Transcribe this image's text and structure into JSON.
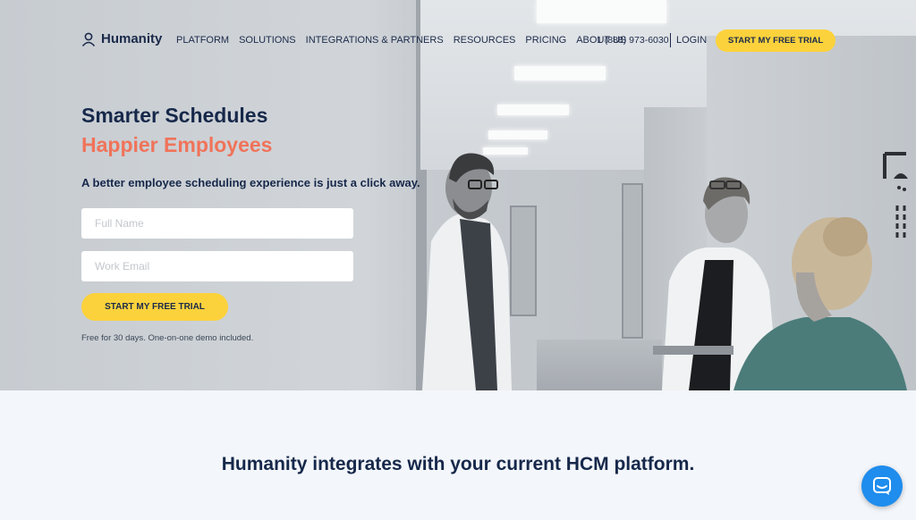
{
  "brand": {
    "name": "Humanity"
  },
  "nav": {
    "links": [
      "PLATFORM",
      "SOLUTIONS",
      "INTEGRATIONS & PARTNERS",
      "RESOURCES",
      "PRICING",
      "ABOUT US"
    ],
    "phone": "1 (888) 973-6030",
    "login": "LOGIN",
    "cta": "START MY FREE TRIAL"
  },
  "hero": {
    "headline": "Smarter Schedules",
    "headline_accent": "Happier Employees",
    "subheadline": "A better employee scheduling experience is just a click away.",
    "form": {
      "name_placeholder": "Full Name",
      "email_placeholder": "Work Email",
      "submit_label": "START MY FREE TRIAL"
    },
    "note": "Free for 30 days. One-on-one demo included."
  },
  "integrations": {
    "title": "Humanity integrates with your current HCM platform."
  },
  "colors": {
    "navy": "#16284a",
    "accent_coral": "#f0735a",
    "cta_yellow": "#fcd23c",
    "chat_blue": "#1f8ded",
    "section_bg": "#f3f6fb"
  },
  "icons": {
    "logo": "user-outline-icon",
    "chat": "chat-bubble-icon",
    "sign": "shower-sign-icon"
  }
}
